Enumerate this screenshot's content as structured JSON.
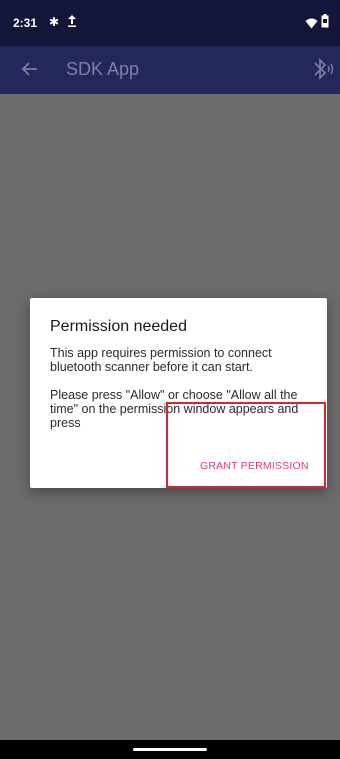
{
  "status_bar": {
    "time": "2:31",
    "bluetooth_glyph": "✱",
    "icons": [
      "bluetooth-icon",
      "upload-icon",
      "wifi-icon",
      "battery-icon"
    ]
  },
  "app_bar": {
    "title": "SDK App",
    "back_icon": "arrow-back-icon",
    "action_icon": "bluetooth-audio-icon"
  },
  "dialog": {
    "title": "Permission needed",
    "message": "This app requires permission to connect bluetooth scanner before it can start.\n\nPlease press \"Allow\" or choose \"Allow all the time\" on the permission window appears and press",
    "button_label": "GRANT PERMISSION"
  },
  "colors": {
    "status_bar": "#13163a",
    "app_bar": "#23275b",
    "scrim": "#6b6b6b",
    "button_text": "#e33e6b",
    "highlight_border": "#d8262a"
  }
}
